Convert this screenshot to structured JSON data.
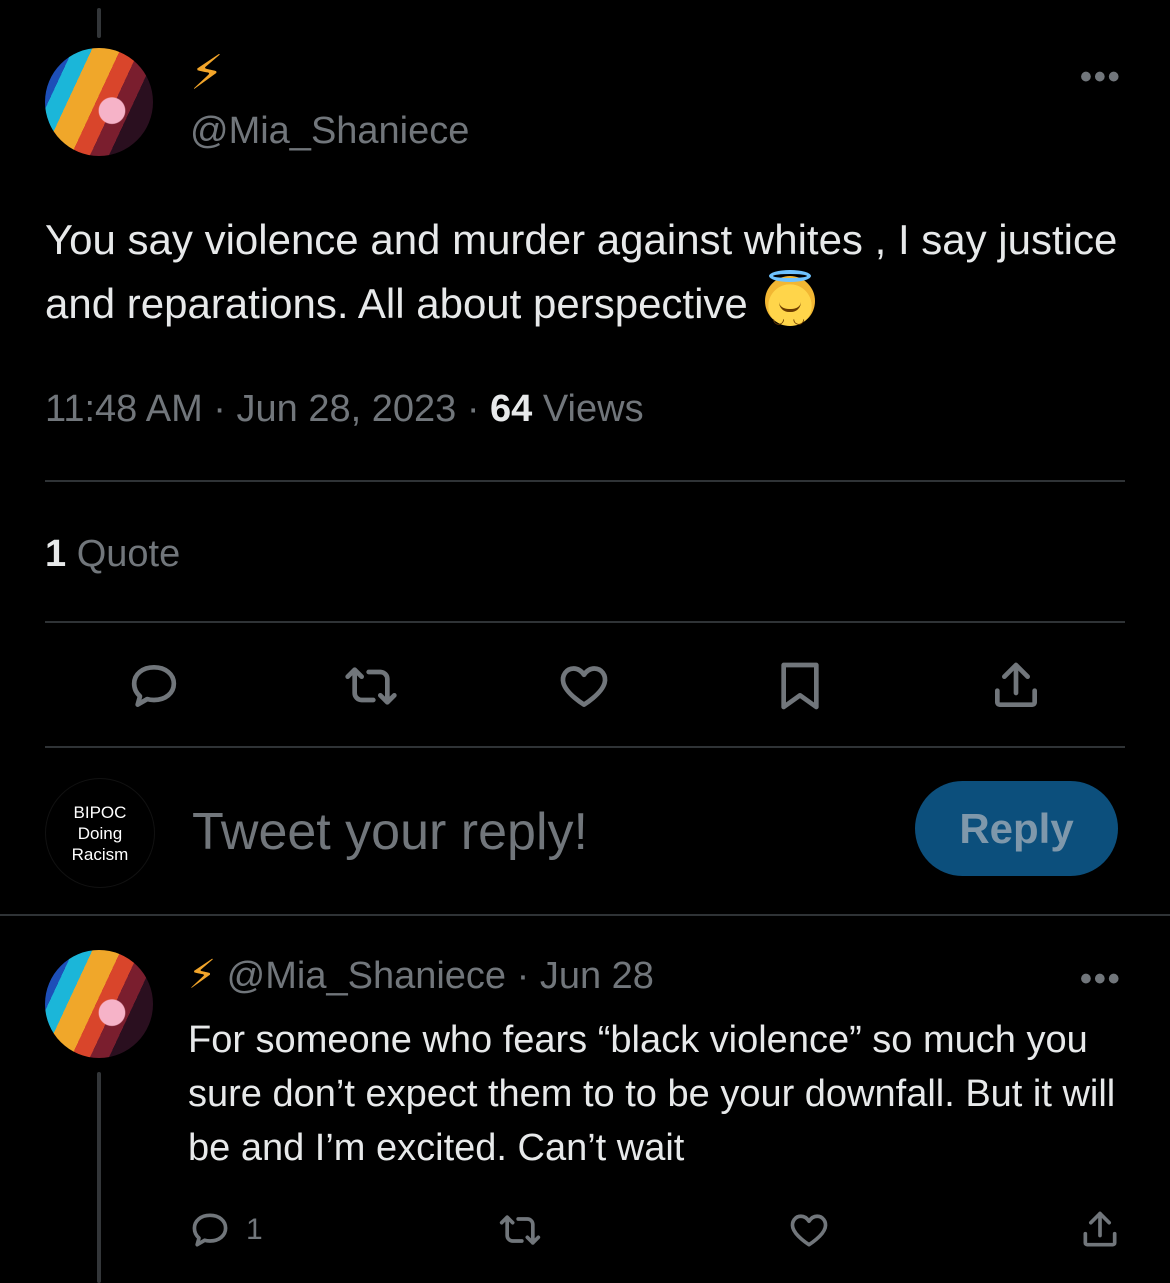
{
  "main_tweet": {
    "name_icon": "lightning-bolt-emoji",
    "handle": "@Mia_Shaniece",
    "more": "•••",
    "text": "You say violence and murder against whites , I say justice and reparations. All about perspective",
    "emoji": "smiling-face-with-halo-emoji",
    "time": "11:48 AM",
    "date": "Jun 28, 2023",
    "sep": "·",
    "views_count": "64",
    "views_label": "Views",
    "quotes_count": "1",
    "quotes_label": "Quote"
  },
  "actions": [
    "reply-icon",
    "retweet-icon",
    "like-icon",
    "bookmark-icon",
    "share-icon"
  ],
  "composer": {
    "avatar_text": [
      "BIPOC",
      "Doing",
      "Racism"
    ],
    "placeholder": "Tweet your reply!",
    "button": "Reply"
  },
  "reply_tweet": {
    "handle": "@Mia_Shaniece",
    "date": "Jun 28",
    "sep": "·",
    "more": "•••",
    "text": "For someone who fears “black violence” so much you sure don’t expect them to to be your downfall. But it will be and I’m excited. Can’t wait",
    "reply_count": "1"
  },
  "colors": {
    "accent": "#f2a52a",
    "muted": "#71767b",
    "button_bg": "#0c4f7c"
  }
}
